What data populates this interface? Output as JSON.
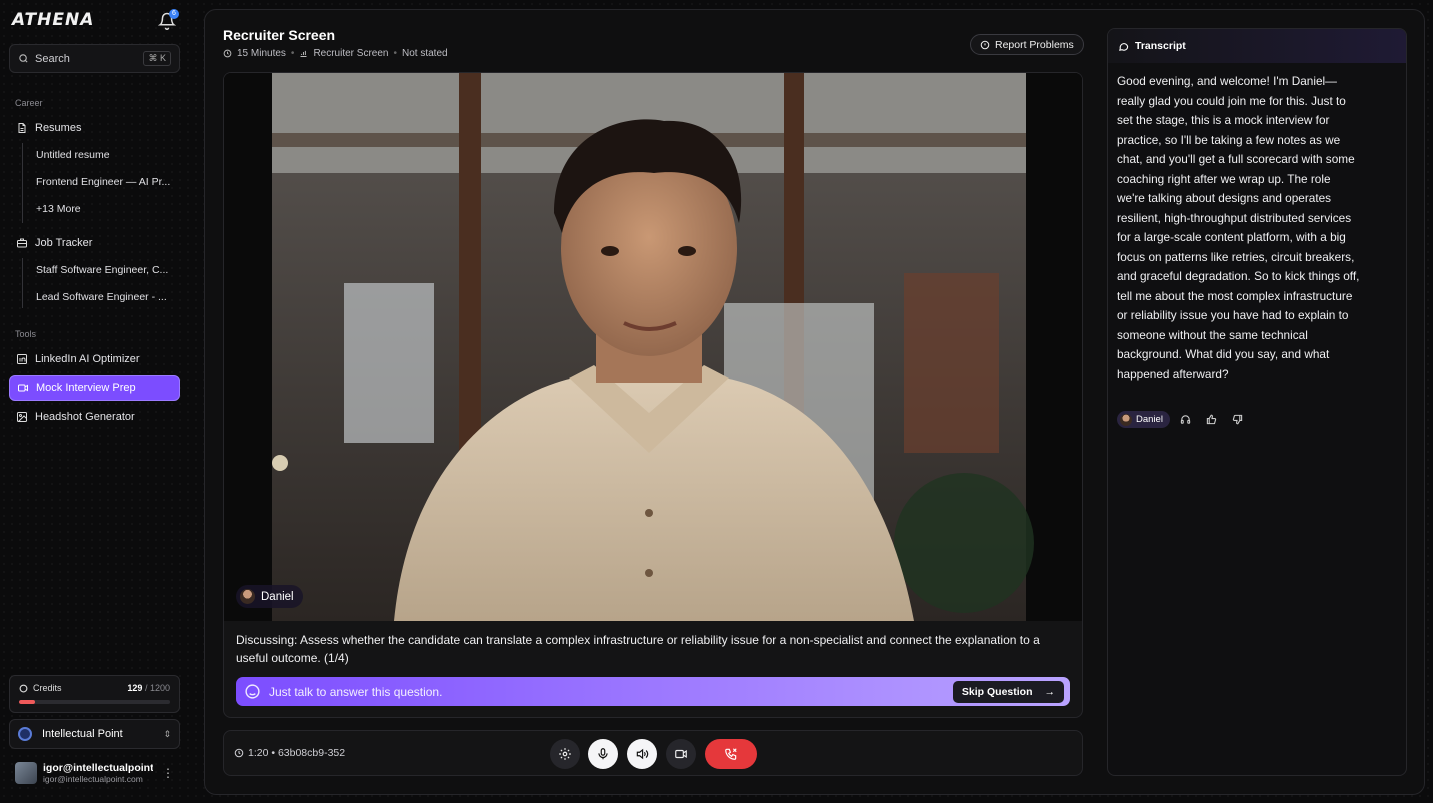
{
  "app": {
    "logo": "ATHENA",
    "notification_count": "6"
  },
  "search": {
    "placeholder": "Search",
    "shortcut": "⌘ K"
  },
  "sidebar": {
    "career_label": "Career",
    "resumes": {
      "label": "Resumes",
      "items": [
        "Untitled resume",
        "Frontend Engineer — AI Pr...",
        "+13 More"
      ]
    },
    "job_tracker": {
      "label": "Job Tracker",
      "items": [
        "Staff Software Engineer, C...",
        "Lead Software Engineer - ..."
      ]
    },
    "tools_label": "Tools",
    "tools": [
      "LinkedIn AI Optimizer",
      "Mock Interview Prep",
      "Headshot Generator"
    ],
    "active_tool": "Mock Interview Prep"
  },
  "credits": {
    "label": "Credits",
    "used": "129",
    "total": "/ 1200",
    "fraction": 0.1075
  },
  "org": {
    "name": "Intellectual Point"
  },
  "user": {
    "name": "igor@intellectualpoint...",
    "email": "igor@intellectualpoint.com"
  },
  "interview": {
    "title": "Recruiter Screen",
    "duration": "15 Minutes",
    "type": "Recruiter Screen",
    "status": "Not stated",
    "report_label": "Report Problems",
    "speaker": "Daniel",
    "discussing": "Discussing: Assess whether the candidate can translate a complex infrastructure or reliability issue for a non-specialist and connect the explanation to a useful outcome. (1/4)",
    "talk_prompt": "Just talk to answer this question.",
    "skip_label": "Skip Question",
    "timer": "1:20 • 63b08cb9-352"
  },
  "transcript": {
    "title": "Transcript",
    "message": "Good evening, and welcome! I'm Daniel—really glad you could join me for this. Just to set the stage, this is a mock interview for practice, so I'll be taking a few notes as we chat, and you'll get a full scorecard with some coaching right after we wrap up. The role we're talking about designs and operates resilient, high-throughput distributed services for a large-scale content platform, with a big focus on patterns like retries, circuit breakers, and graceful degradation. So to kick things off, tell me about the most complex infrastructure or reliability issue you have had to explain to someone without the same technical background. What did you say, and what happened afterward?",
    "speaker": "Daniel"
  },
  "colors": {
    "accent": "#7c4dff",
    "end_call": "#e5383b",
    "credits_bar": "#ef5a5a"
  },
  "icons": [
    "bell-icon",
    "search-icon",
    "file-icon",
    "briefcase-icon",
    "linkedin-icon",
    "video-icon",
    "image-icon",
    "clock-icon",
    "chart-icon",
    "alert-icon",
    "chat-icon",
    "settings-icon",
    "mic-icon",
    "speaker-icon",
    "camera-icon",
    "phone-end-icon",
    "headphones-icon",
    "thumbs-up-icon",
    "thumbs-down-icon",
    "more-icon"
  ]
}
